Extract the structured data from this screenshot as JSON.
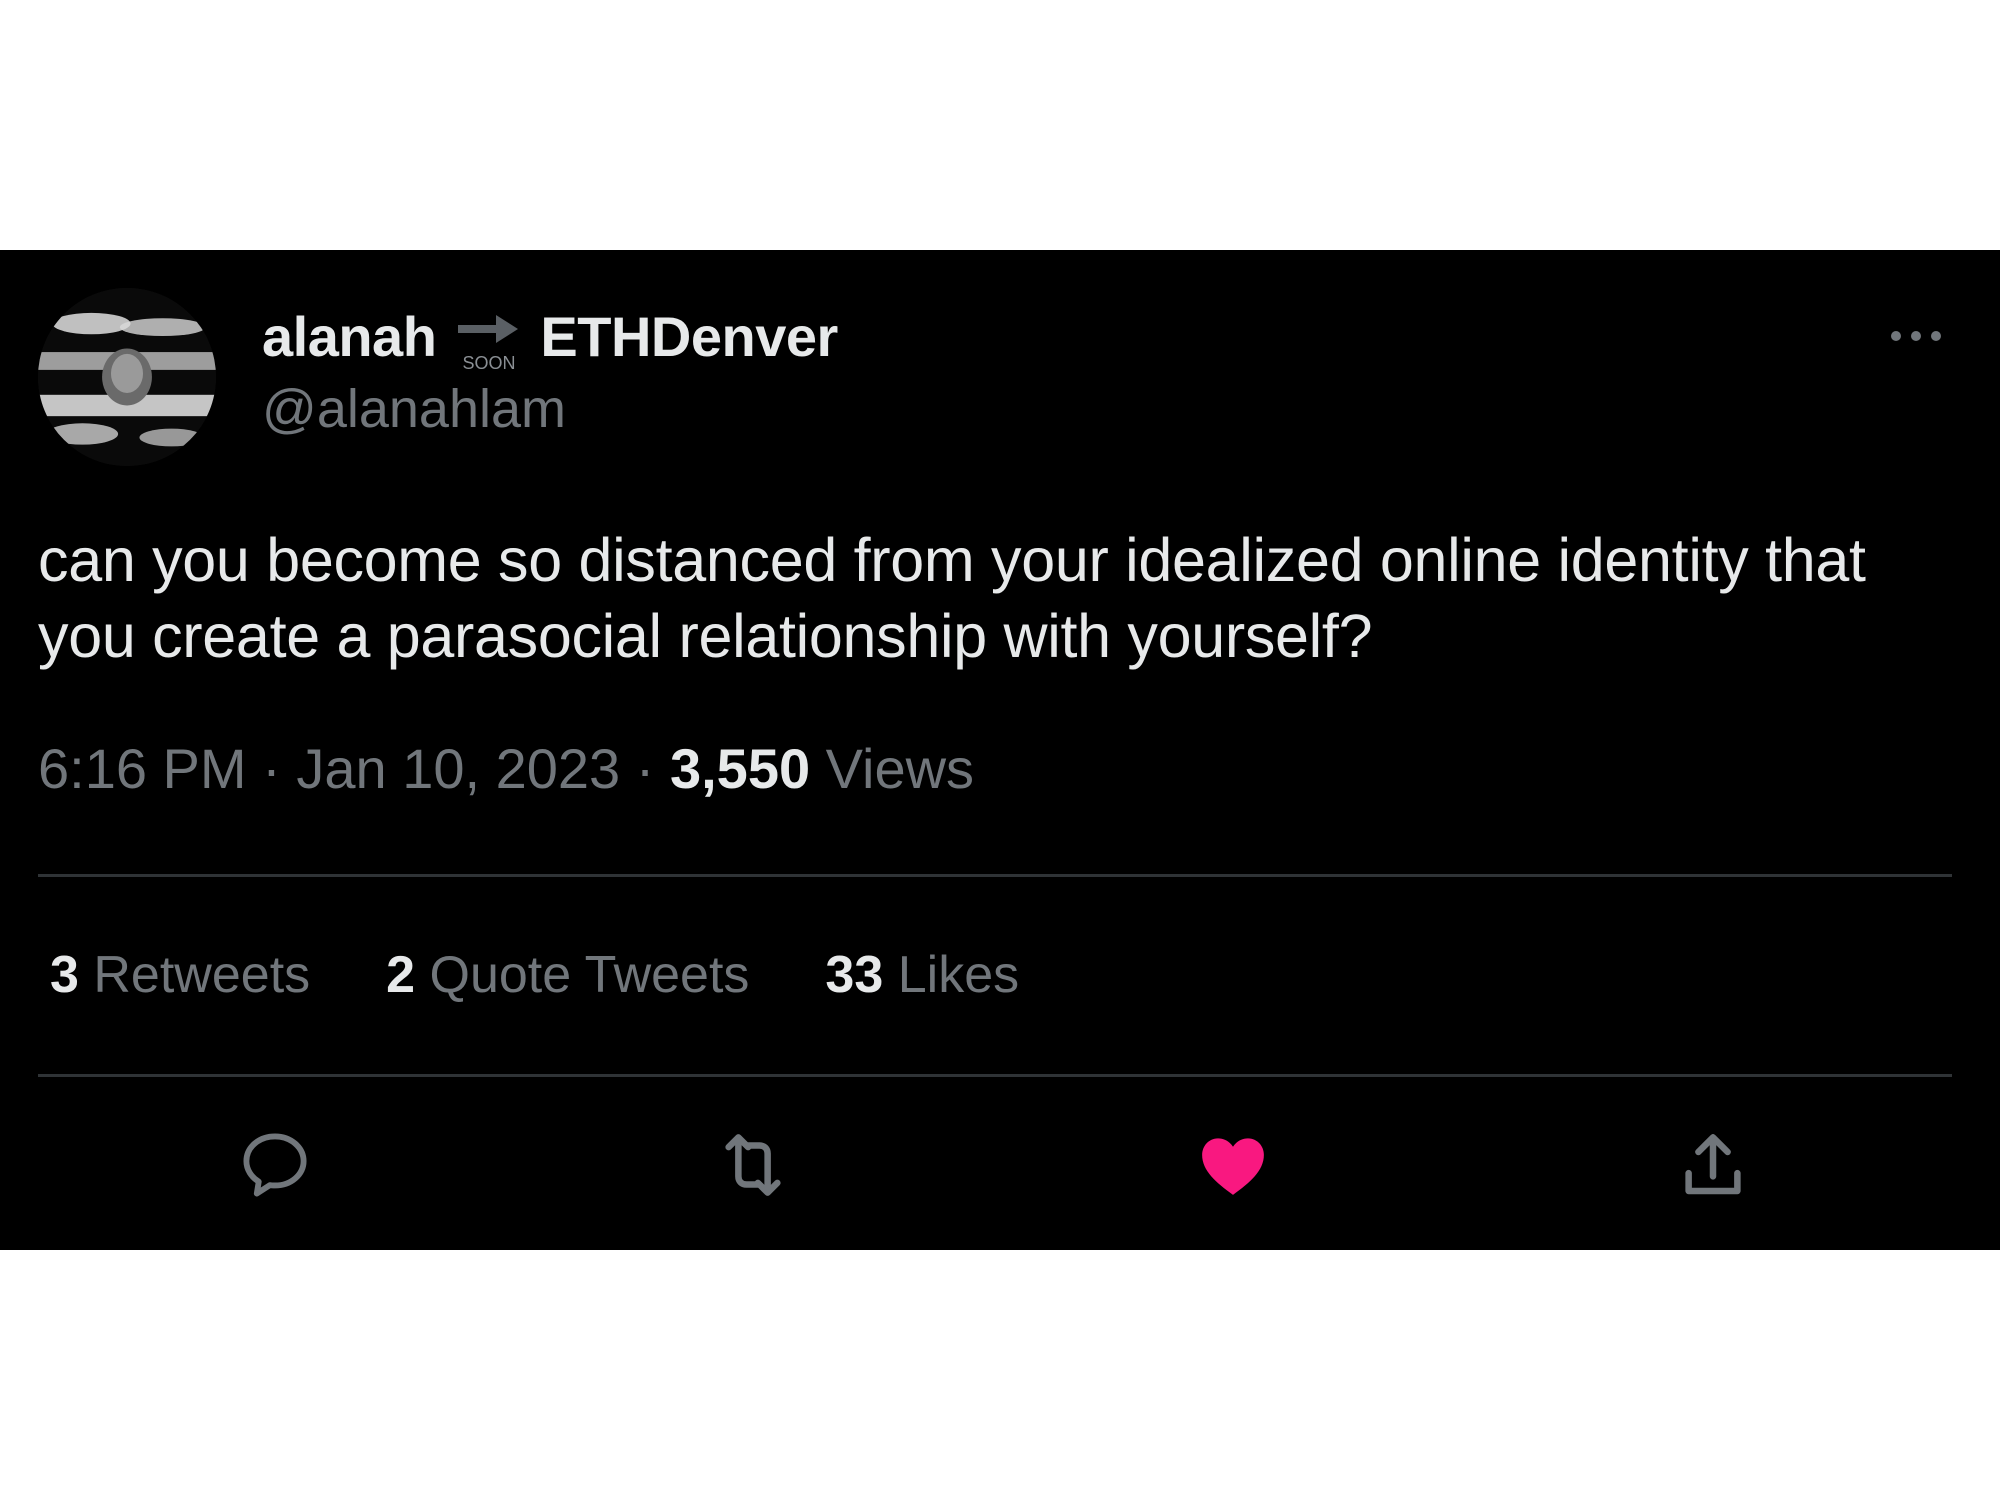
{
  "tweet": {
    "author": {
      "name_part_1": "alanah",
      "name_emoji": "soon-arrow-icon",
      "name_part_2": "ETHDenver",
      "handle": "@alanahlam"
    },
    "text": "can you become so distanced from your idealized online identity that you create a parasocial relationship with yourself?",
    "time": "6:16 PM",
    "separator": "·",
    "date": "Jan 10, 2023",
    "views_count": "3,550",
    "views_label": "Views",
    "stats": {
      "retweets_count": "3",
      "retweets_label": "Retweets",
      "quotes_count": "2",
      "quotes_label": "Quote Tweets",
      "likes_count": "33",
      "likes_label": "Likes"
    },
    "actions": [
      "reply-icon",
      "retweet-icon",
      "heart-icon",
      "share-icon"
    ],
    "liked": true
  },
  "colors": {
    "background": "#000000",
    "primary_text": "#e7e9ea",
    "secondary_text": "#71767b",
    "divider": "#2f3336",
    "like_active": "#f91880"
  }
}
